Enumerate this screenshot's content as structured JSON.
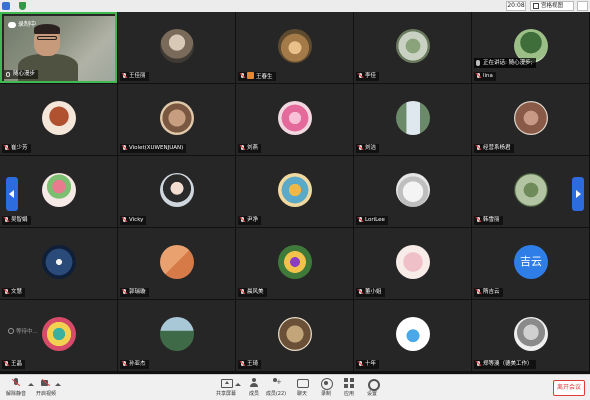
{
  "topbar": {
    "time": "20:08",
    "view_label": "宫格视图"
  },
  "speaker_tile": {
    "recording_label": "录制中",
    "speaking_now": "正在讲话: 随心漫步;",
    "name": "随心漫步"
  },
  "tiles": [
    {
      "name": "",
      "avatar": "speaker-video"
    },
    {
      "name": "王佳丽",
      "avatar": "cat"
    },
    {
      "name": "王春生",
      "avatar": "child",
      "badge": true
    },
    {
      "name": "李佳",
      "avatar": "plant"
    },
    {
      "name": "lina",
      "avatar": "tree",
      "speaking": true
    },
    {
      "name": "崔少芳",
      "avatar": "poodle"
    },
    {
      "name": "Violet(XUWENJUAN)",
      "avatar": "portrait"
    },
    {
      "name": "刘燕",
      "avatar": "pink-flower"
    },
    {
      "name": "刘洁",
      "avatar": "waterfall"
    },
    {
      "name": "经营系杨君",
      "avatar": "monkey"
    },
    {
      "name": "吴智娟",
      "avatar": "tulip"
    },
    {
      "name": "Vicky",
      "avatar": "woman"
    },
    {
      "name": "尹净",
      "avatar": "cartoon"
    },
    {
      "name": "LoriLee",
      "avatar": "bunny"
    },
    {
      "name": "韩雪丽",
      "avatar": "garden"
    },
    {
      "name": "文慧",
      "avatar": "dark-art"
    },
    {
      "name": "郭瑞璇",
      "avatar": "orange"
    },
    {
      "name": "晨风美",
      "avatar": "girl-flower"
    },
    {
      "name": "董小姐",
      "avatar": "flower-bowl"
    },
    {
      "name": "隋吉云",
      "avatar": "text-avatar",
      "avatar_text": "吉云"
    },
    {
      "name": "王晶",
      "avatar": "cartoon2",
      "placeholder": "等待中..."
    },
    {
      "name": "孙亚杰",
      "avatar": "landscape"
    },
    {
      "name": "王琦",
      "avatar": "sculpture"
    },
    {
      "name": "十年",
      "avatar": "whale"
    },
    {
      "name": "郑等澳（德美工作）",
      "avatar": "girl-sketch"
    }
  ],
  "toolbar": {
    "unmute_label": "解除静音",
    "video_label": "开启视频",
    "share_label": "共享屏幕",
    "members_label": "成员",
    "invite_label": "成员(22)",
    "chat_label": "聊天",
    "record_label": "录制",
    "apps_label": "应用",
    "settings_label": "设置",
    "leave_label": "离开会议"
  },
  "colors": {
    "speaker_border": "#3fb950",
    "accent_blue": "#2d6cdf",
    "leave_red": "#e03c3c"
  }
}
